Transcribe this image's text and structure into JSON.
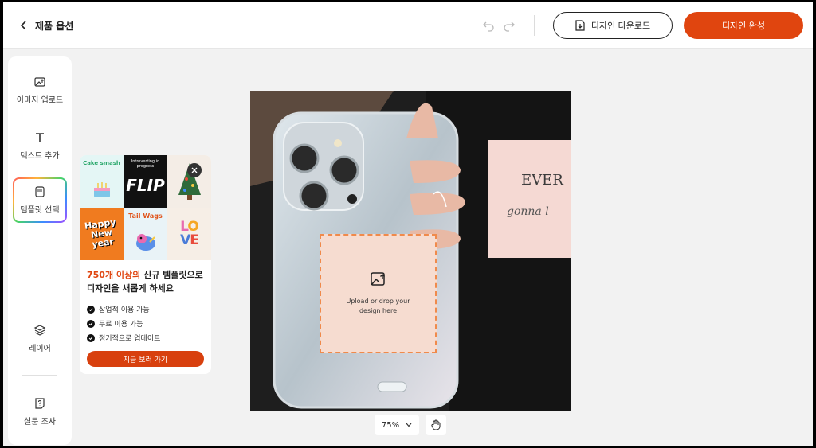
{
  "header": {
    "back_label": "제품 옵션",
    "download_label": "디자인 다운로드",
    "done_label": "디자인 완성"
  },
  "sidebar": {
    "items": [
      {
        "label": "이미지 업로드",
        "icon": "image-upload-icon"
      },
      {
        "label": "텍스트 추가",
        "icon": "text-icon"
      },
      {
        "label": "템플릿 선택",
        "icon": "template-icon"
      },
      {
        "label": "레이어",
        "icon": "layers-icon"
      },
      {
        "label": "설문 조사",
        "icon": "survey-icon"
      }
    ]
  },
  "promo": {
    "tiles": [
      "Cake smash",
      "Introverting in progress",
      "FLIP",
      "Happy New year",
      "Tail Wags",
      "LOVE"
    ],
    "title_highlight": "750개 이상의",
    "title_rest": " 신규 템플릿으로",
    "title_line2": "디자인을 새롭게 하세요",
    "features": [
      "상업적 이용 가능",
      "무료 이용 가능",
      "정기적으로 업데이트"
    ],
    "cta": "지금 보러 가기"
  },
  "canvas": {
    "upload_text": "Upload or drop your design here",
    "card_text_1": "EVER",
    "card_text_2": "gonna l"
  },
  "zoom": {
    "level": "75%"
  },
  "colors": {
    "accent": "#e0450f",
    "upload_dash": "#f08a4b"
  }
}
